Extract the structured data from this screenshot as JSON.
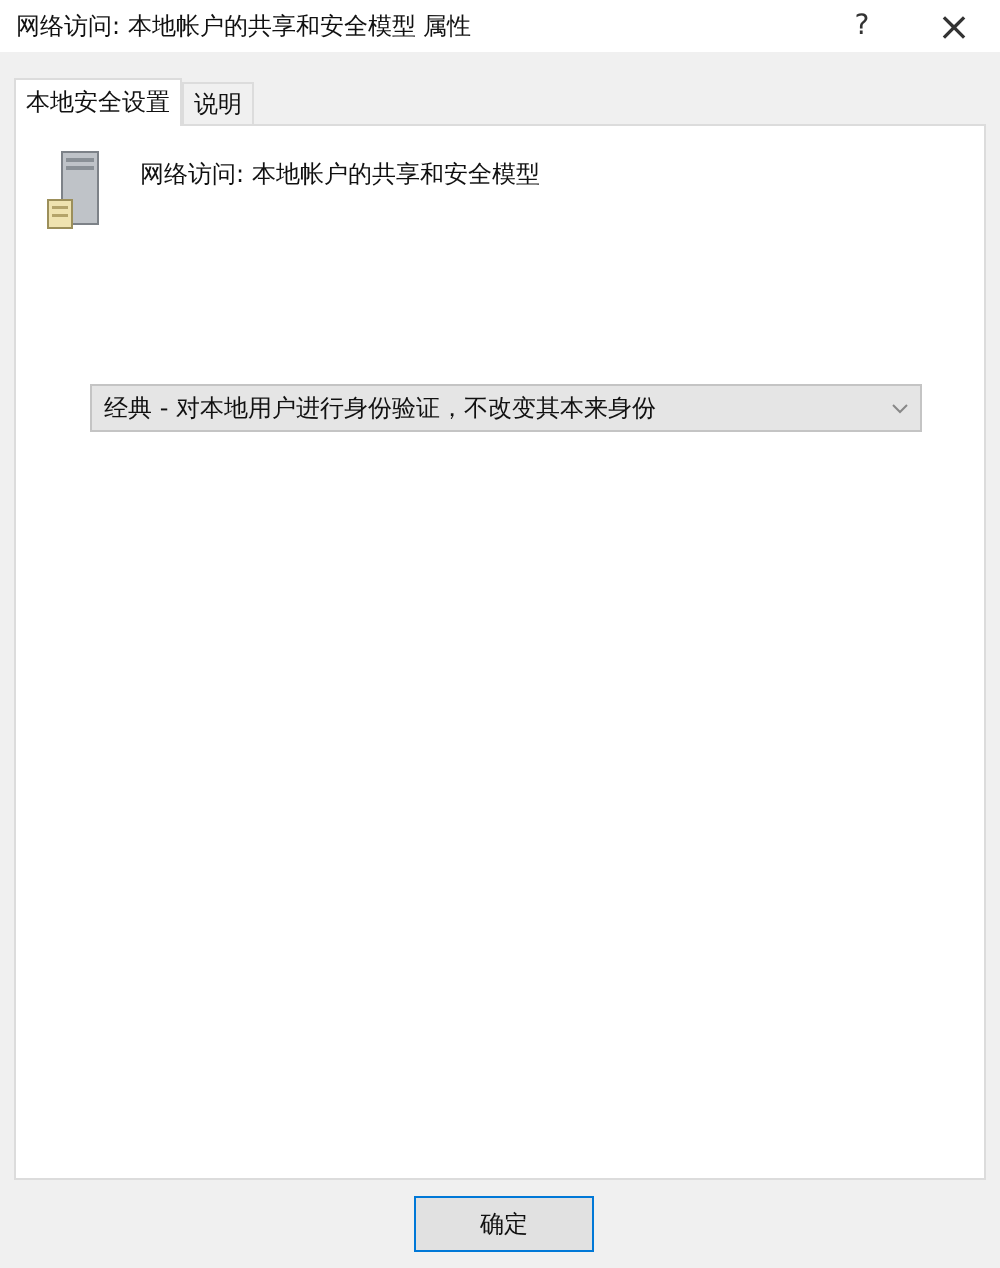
{
  "window": {
    "title": "网络访问: 本地帐户的共享和安全模型 属性",
    "help": "?",
    "close": "×"
  },
  "tabs": [
    {
      "label": "本地安全设置",
      "selected": true
    },
    {
      "label": "说明",
      "selected": false
    }
  ],
  "policy": {
    "name": "网络访问: 本地帐户的共享和安全模型"
  },
  "dropdown": {
    "value": "经典 - 对本地用户进行身份验证，不改变其本来身份"
  },
  "buttons": [
    {
      "label": "确定",
      "focused": true
    }
  ]
}
